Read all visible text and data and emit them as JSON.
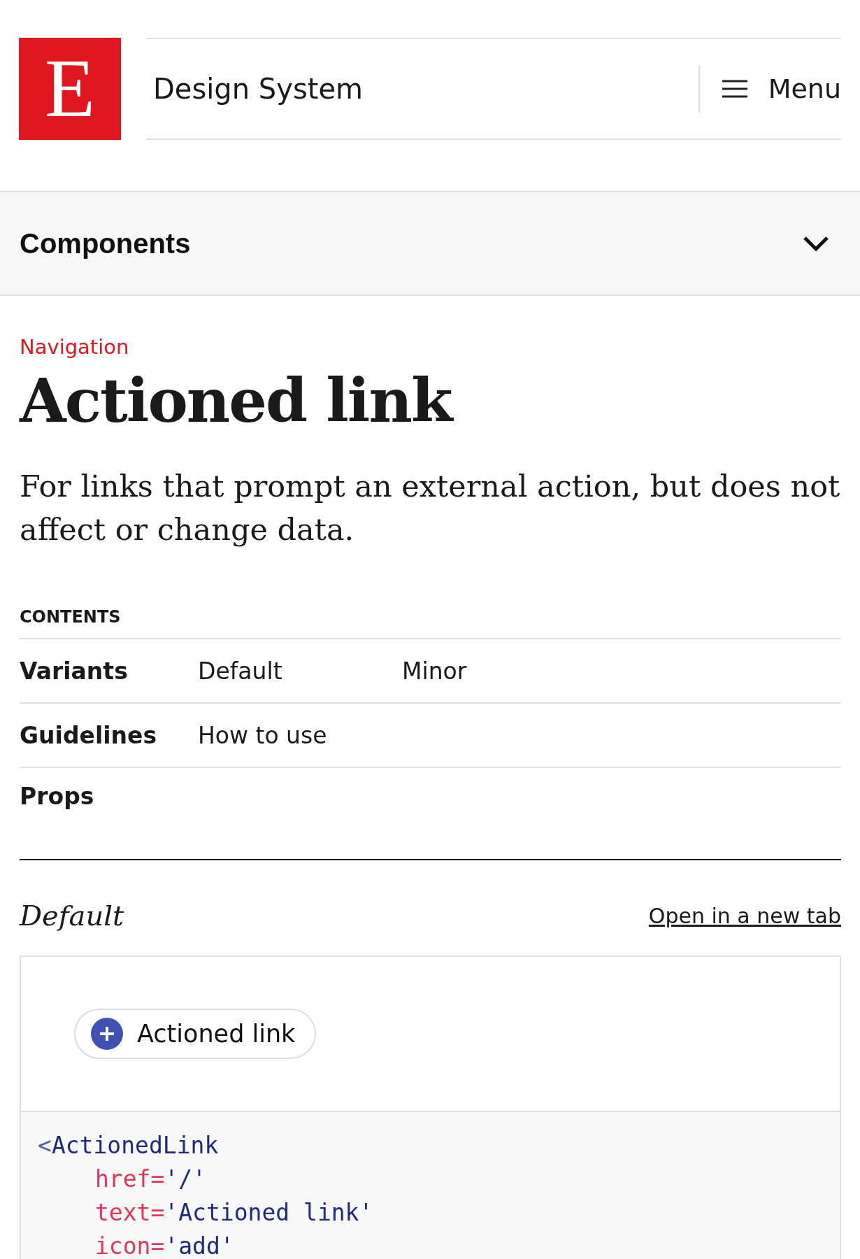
{
  "header": {
    "logo_letter": "E",
    "title": "Design System",
    "menu_label": "Menu"
  },
  "section_bar": {
    "label": "Components",
    "expanded": false
  },
  "page": {
    "category": "Navigation",
    "title": "Actioned link",
    "description": "For links that prompt an external action, but does not affect or change data."
  },
  "contents": {
    "heading": "CONTENTS",
    "rows": [
      {
        "label": "Variants",
        "links": [
          "Default",
          "Minor"
        ]
      },
      {
        "label": "Guidelines",
        "links": [
          "How to use"
        ]
      },
      {
        "label": "Props",
        "links": []
      }
    ]
  },
  "example": {
    "title": "Default",
    "open_link": "Open in a new tab",
    "demo_button": {
      "label": "Actioned link"
    },
    "code": [
      {
        "indent": false,
        "tokens": [
          {
            "text": "<",
            "kind": "bracket"
          },
          {
            "text": "ActionedLink",
            "kind": "tag"
          }
        ]
      },
      {
        "indent": true,
        "tokens": [
          {
            "text": "href=",
            "kind": "attr"
          },
          {
            "text": "'/'",
            "kind": "value"
          }
        ]
      },
      {
        "indent": true,
        "tokens": [
          {
            "text": "text=",
            "kind": "attr"
          },
          {
            "text": "'Actioned link'",
            "kind": "value"
          }
        ]
      },
      {
        "indent": true,
        "tokens": [
          {
            "text": "icon=",
            "kind": "attr"
          },
          {
            "text": "'add'",
            "kind": "value"
          }
        ]
      }
    ]
  }
}
